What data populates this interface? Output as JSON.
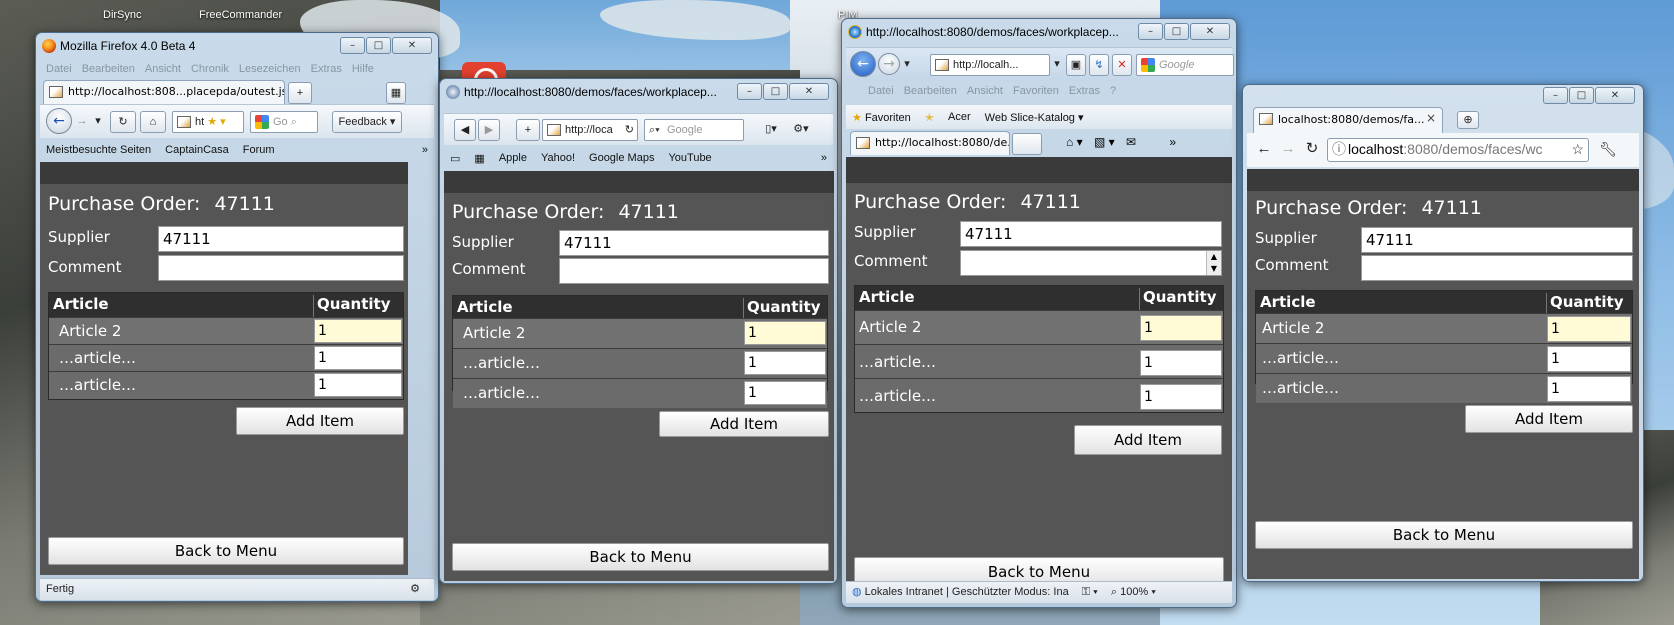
{
  "desktop": {
    "labels": [
      "DirSync",
      "FreeCommander",
      "PIM"
    ]
  },
  "app": {
    "po_label": "Purchase Order:",
    "po_number": "47111",
    "supplier_label": "Supplier",
    "supplier_value": "47111",
    "comment_label": "Comment",
    "comment_value": "",
    "col_article": "Article",
    "col_quantity": "Quantity",
    "rows": [
      {
        "article": "Article 2",
        "quantity": "1"
      },
      {
        "article": "…article…",
        "quantity": "1"
      },
      {
        "article": "…article…",
        "quantity": "1"
      }
    ],
    "add_item": "Add Item",
    "back_to_menu": "Back to Menu"
  },
  "windows": {
    "firefox": {
      "title": "Mozilla Firefox 4.0 Beta 4",
      "menu": [
        "Datei",
        "Bearbeiten",
        "Ansicht",
        "Chronik",
        "Lesezeichen",
        "Extras",
        "Hilfe"
      ],
      "tab_label": "http://localhost:808...placepda/outest.jsp",
      "tab_new": "+",
      "address_value": "ht",
      "search_value": "Go",
      "feedback_label": "Feedback",
      "bookmarks": [
        "Meistbesuchte Seiten",
        "CaptainCasa",
        "Forum"
      ],
      "bookmarks_more": "»",
      "status": "Fertig"
    },
    "opera": {
      "title": "http://localhost:8080/demos/faces/workplacep...",
      "address_value": "http://loca",
      "search_placeholder": "Google",
      "bookmarks": [
        "Apple",
        "Yahoo!",
        "Google Maps",
        "YouTube"
      ],
      "bookmarks_more": "»"
    },
    "ie": {
      "title": "http://localhost:8080/demos/faces/workplacep...",
      "address_value": "http://localh...",
      "search_placeholder": "Google",
      "menu": [
        "Datei",
        "Bearbeiten",
        "Ansicht",
        "Favoriten",
        "Extras",
        "?"
      ],
      "favorites_label": "Favoriten",
      "fav_items": [
        "Acer",
        "Web Slice-Katalog"
      ],
      "tab_label": "http://localhost:8080/de...",
      "status": "Lokales Intranet | Geschützter Modus: Ina",
      "zoom": "100%"
    },
    "chrome": {
      "tab_label": "localhost:8080/demos/fa...",
      "tab_close": "×",
      "address_host": "localhost",
      "address_rest": ":8080/demos/faces/wc"
    }
  }
}
